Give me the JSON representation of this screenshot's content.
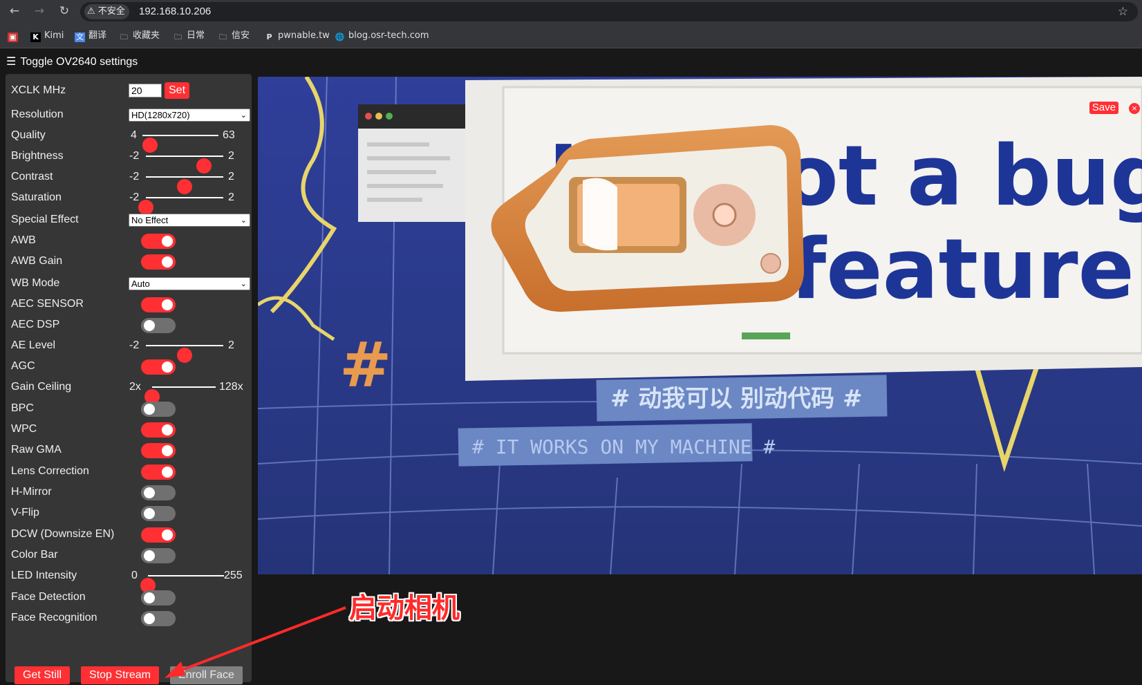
{
  "browser": {
    "url": "192.168.10.206",
    "security_label": "不安全",
    "bookmarks": [
      {
        "label": "",
        "icon": "app-icon"
      },
      {
        "label": "Kimi",
        "icon": "kimi-icon"
      },
      {
        "label": "翻译",
        "icon": "translate-icon"
      },
      {
        "label": "收藏夹",
        "icon": "folder-icon"
      },
      {
        "label": "日常",
        "icon": "folder-icon"
      },
      {
        "label": "信安",
        "icon": "folder-icon"
      },
      {
        "label": "pwnable.tw",
        "icon": "pwnable-icon"
      },
      {
        "label": "blog.osr-tech.com",
        "icon": "globe-icon"
      }
    ]
  },
  "header": {
    "toggle_label": "Toggle OV2640 settings"
  },
  "settings": {
    "xclk": {
      "label": "XCLK MHz",
      "value": "20",
      "button": "Set"
    },
    "resolution": {
      "label": "Resolution",
      "value": "HD(1280x720)"
    },
    "quality": {
      "label": "Quality",
      "min": "4",
      "max": "63",
      "value": 10
    },
    "brightness": {
      "label": "Brightness",
      "min": "-2",
      "max": "2",
      "value": 1
    },
    "contrast": {
      "label": "Contrast",
      "min": "-2",
      "max": "2",
      "value": 0
    },
    "saturation": {
      "label": "Saturation",
      "min": "-2",
      "max": "2",
      "value": -2
    },
    "special_effect": {
      "label": "Special Effect",
      "value": "No Effect"
    },
    "awb": {
      "label": "AWB",
      "on": true
    },
    "awb_gain": {
      "label": "AWB Gain",
      "on": true
    },
    "wb_mode": {
      "label": "WB Mode",
      "value": "Auto"
    },
    "aec_sensor": {
      "label": "AEC SENSOR",
      "on": true
    },
    "aec_dsp": {
      "label": "AEC DSP",
      "on": false
    },
    "ae_level": {
      "label": "AE Level",
      "min": "-2",
      "max": "2",
      "value": 0
    },
    "agc": {
      "label": "AGC",
      "on": true
    },
    "gain_ceiling": {
      "label": "Gain Ceiling",
      "min": "2x",
      "max": "128x",
      "value": 0
    },
    "bpc": {
      "label": "BPC",
      "on": false
    },
    "wpc": {
      "label": "WPC",
      "on": true
    },
    "raw_gma": {
      "label": "Raw GMA",
      "on": true
    },
    "lens_correction": {
      "label": "Lens Correction",
      "on": true
    },
    "h_mirror": {
      "label": "H-Mirror",
      "on": false
    },
    "v_flip": {
      "label": "V-Flip",
      "on": false
    },
    "dcw": {
      "label": "DCW (Downsize EN)",
      "on": true
    },
    "color_bar": {
      "label": "Color Bar",
      "on": false
    },
    "led_intensity": {
      "label": "LED Intensity",
      "min": "0",
      "max": "255",
      "value": 0
    },
    "face_detection": {
      "label": "Face Detection",
      "on": false
    },
    "face_recognition": {
      "label": "Face Recognition",
      "on": false
    }
  },
  "buttons": {
    "get_still": "Get Still",
    "stop_stream": "Stop Stream",
    "enroll_face": "Enroll Face"
  },
  "stream": {
    "save": "Save",
    "close": "×",
    "poster_text_1": "It's not a bug",
    "poster_text_2": "feature",
    "banner_1": "# 动我可以 别动代码 #",
    "banner_2": "# IT WORKS ON MY MACHINE #"
  },
  "annotation": {
    "text": "启动相机"
  },
  "colors": {
    "accent": "#ff3034",
    "panel": "#363636",
    "background": "#181818"
  }
}
